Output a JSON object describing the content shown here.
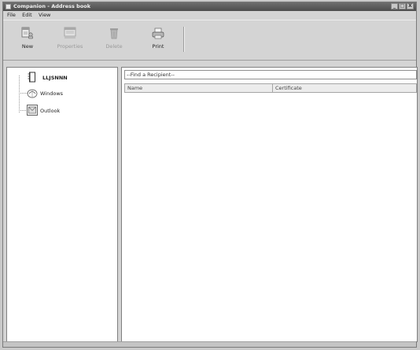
{
  "window": {
    "title": "Companion - Address book",
    "controls": [
      "_",
      "□",
      "X"
    ]
  },
  "menu": [
    "File",
    "Edit",
    "View"
  ],
  "toolbar": {
    "buttons": [
      {
        "label": "New",
        "icon": "new-contact-icon",
        "enabled": true
      },
      {
        "label": "Properties",
        "icon": "properties-icon",
        "enabled": false
      },
      {
        "label": "Delete",
        "icon": "delete-icon",
        "enabled": false
      },
      {
        "label": "Print",
        "icon": "printer-icon",
        "enabled": true
      }
    ]
  },
  "tree": {
    "root": {
      "label": "LLJSNNN",
      "icon": "address-book-icon"
    },
    "children": [
      {
        "label": "Windows",
        "icon": "windows-contacts-icon"
      },
      {
        "label": "Outlook",
        "icon": "outlook-icon"
      }
    ]
  },
  "search": {
    "placeholder": "--Find a Recipient--",
    "value": "--Find a Recipient--"
  },
  "list": {
    "columns": [
      "Name",
      "Certificate"
    ],
    "rows": []
  },
  "colors": {
    "title_bar": "#5a5a5a",
    "chrome": "#d4d4d4",
    "pane_background": "#ffffff"
  }
}
